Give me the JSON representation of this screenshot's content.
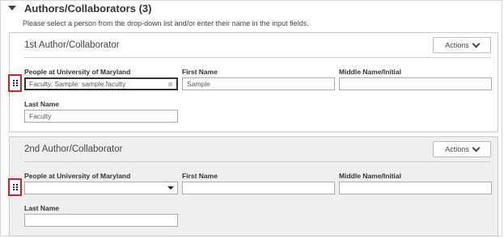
{
  "section": {
    "title": "Authors/Collaborators (3)",
    "instructions": "Please select a person from the drop-down list and/or enter their name in the input fields."
  },
  "labels": {
    "people": "People at University of Maryland",
    "first_name": "First Name",
    "middle_name": "Middle Name/Initial",
    "last_name": "Last Name"
  },
  "authors": [
    {
      "title": "1st Author/Collaborator",
      "actions_label": "Actions",
      "people_value": "Faculty, Sample: sample.faculty",
      "first_name": "Sample",
      "middle_name": "",
      "last_name": "Faculty"
    },
    {
      "title": "2nd Author/Collaborator",
      "actions_label": "Actions",
      "people_value": "",
      "first_name": "",
      "middle_name": "",
      "last_name": ""
    }
  ],
  "icons": {
    "section_toggle": "caret-down-icon",
    "actions": "chevron-down-icon",
    "drag": "drag-handle-icon",
    "clear": "clear-icon",
    "dropdown": "dropdown-arrow-icon"
  },
  "colors": {
    "card2_background": "#efefef",
    "drag_highlight": "#d21f2b"
  }
}
